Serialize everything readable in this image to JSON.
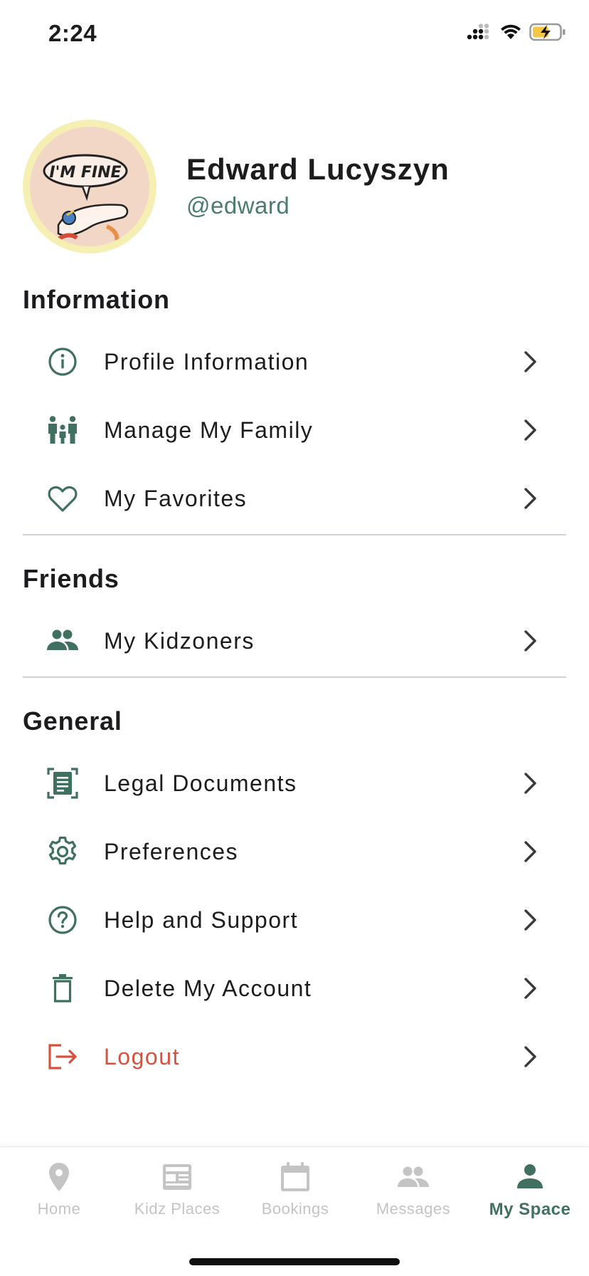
{
  "status_bar": {
    "time": "2:24",
    "icons": [
      "cellular-signal-icon",
      "wifi-icon",
      "battery-charging-icon"
    ]
  },
  "profile": {
    "avatar_text": "I'M FINE",
    "name": "Edward Lucyszyn",
    "handle": "@edward"
  },
  "sections": {
    "information": {
      "title": "Information",
      "items": [
        {
          "label": "Profile Information",
          "icon": "info-circle-icon"
        },
        {
          "label": "Manage My Family",
          "icon": "family-icon"
        },
        {
          "label": "My Favorites",
          "icon": "heart-icon"
        }
      ]
    },
    "friends": {
      "title": "Friends",
      "items": [
        {
          "label": "My Kidzoners",
          "icon": "people-icon"
        }
      ]
    },
    "general": {
      "title": "General",
      "items": [
        {
          "label": "Legal Documents",
          "icon": "document-icon"
        },
        {
          "label": "Preferences",
          "icon": "gear-icon"
        },
        {
          "label": "Help and Support",
          "icon": "help-circle-icon"
        },
        {
          "label": "Delete My Account",
          "icon": "trash-icon"
        },
        {
          "label": "Logout",
          "icon": "logout-icon"
        }
      ]
    }
  },
  "tab_bar": {
    "tabs": [
      {
        "label": "Home",
        "icon": "location-pin-icon",
        "active": false
      },
      {
        "label": "Kidz Places",
        "icon": "newspaper-icon",
        "active": false
      },
      {
        "label": "Bookings",
        "icon": "calendar-icon",
        "active": false
      },
      {
        "label": "Messages",
        "icon": "people-icon",
        "active": false
      },
      {
        "label": "My Space",
        "icon": "person-icon",
        "active": true
      }
    ]
  },
  "colors": {
    "accent": "#3f7060",
    "handle": "#4c7c6a",
    "logout": "#d9513c",
    "inactive_tab": "#c4c4c4",
    "avatar_ring": "#f6efb4"
  }
}
